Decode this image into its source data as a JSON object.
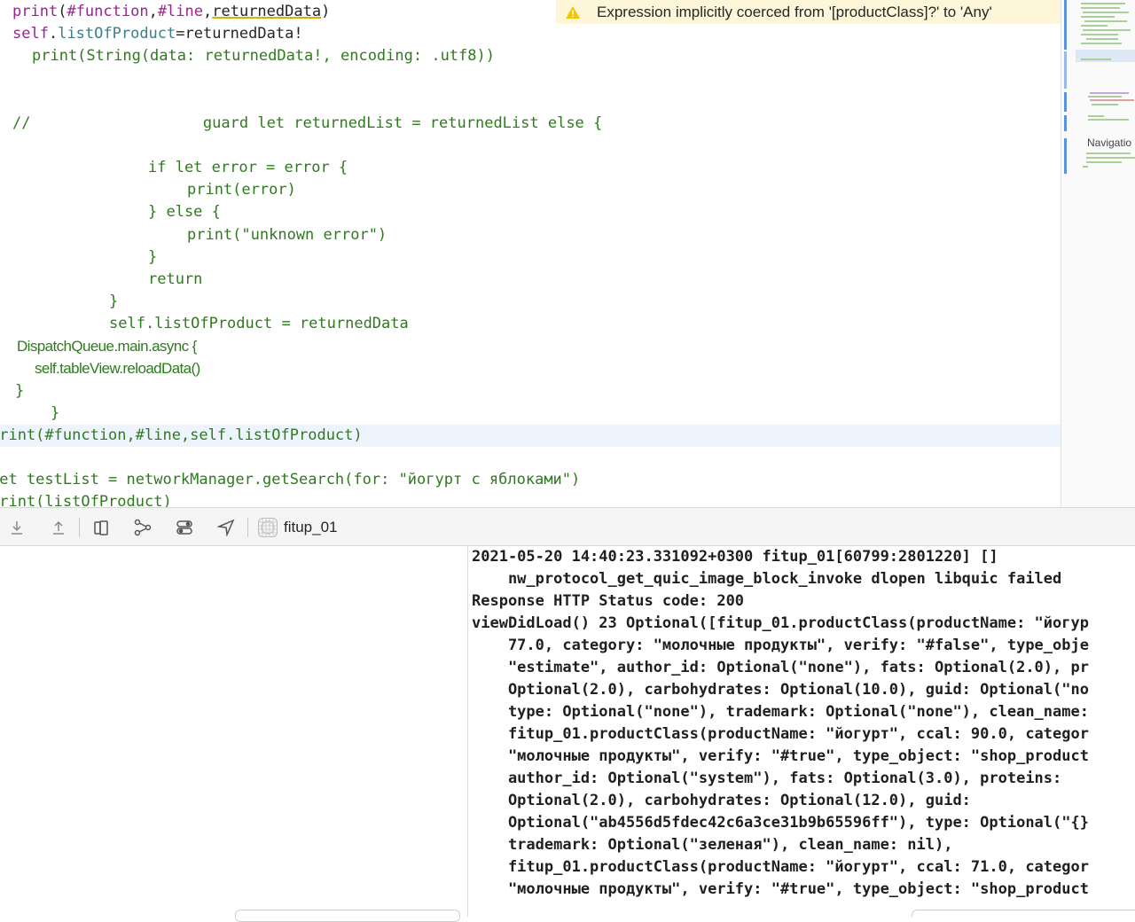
{
  "editor": {
    "warning": {
      "icon": "warning-triangle-icon",
      "text": "Expression implicitly coerced from '[productClass]?' to 'Any'"
    },
    "lines": [
      {
        "print": "print",
        "open": "(",
        "function_kw": "#function",
        "comma1": ",",
        "line_kw": "#line",
        "comma2": ",",
        "arg": "returnedData",
        "close": ")"
      },
      {
        "self_kw": "self",
        "dot": ".",
        "member": "listOfProduct",
        "rest": "=returnedData!"
      },
      {
        "text": "print(String(data: returnedData!, encoding: .utf8))"
      },
      {
        "text": "//                   guard let returnedList = returnedList else {"
      },
      {
        "text": "if let error = error {"
      },
      {
        "text": "print(error)"
      },
      {
        "text": "} else {"
      },
      {
        "text": "print(\"unknown error\")"
      },
      {
        "text": "}"
      },
      {
        "text": "return"
      },
      {
        "text": "}"
      },
      {
        "text": "self.listOfProduct = returnedData"
      },
      {
        "text": "DispatchQueue.main.async {"
      },
      {
        "text": "self.tableView.reloadData()"
      },
      {
        "text": "}"
      },
      {
        "text": "}"
      },
      {
        "text": "print(#function,#line,self.listOfProduct)"
      },
      {
        "text": "let testList = networkManager.getSearch(for: \"йогурт с яблоками\")"
      },
      {
        "text": "print(listOfProduct)"
      }
    ]
  },
  "minimap": {
    "label": "Navigatio"
  },
  "toolbar": {
    "icons": [
      "step-over-icon",
      "step-out-icon",
      "view-debugger-icon",
      "memory-graph-icon",
      "environment-overrides-icon",
      "simulate-location-icon"
    ],
    "target_icon": "app-target-icon",
    "target_label": "fitup_01"
  },
  "console": {
    "lines": [
      "2021-05-20 14:40:23.331092+0300 fitup_01[60799:2801220] []",
      "    nw_protocol_get_quic_image_block_invoke dlopen libquic failed",
      "Response HTTP Status code: 200",
      "viewDidLoad() 23 Optional([fitup_01.productClass(productName: \"йогур",
      "    77.0, category: \"молочные продукты\", verify: \"#false\", type_obje",
      "    \"estimate\", author_id: Optional(\"none\"), fats: Optional(2.0), pr",
      "    Optional(2.0), carbohydrates: Optional(10.0), guid: Optional(\"no",
      "    type: Optional(\"none\"), trademark: Optional(\"none\"), clean_name:",
      "    fitup_01.productClass(productName: \"йогурт\", ccal: 90.0, categor",
      "    \"молочные продукты\", verify: \"#true\", type_object: \"shop_product",
      "    author_id: Optional(\"system\"), fats: Optional(3.0), proteins:",
      "    Optional(2.0), carbohydrates: Optional(12.0), guid:",
      "    Optional(\"ab4556d5fdec42c6a3ce31b9b65596ff\"), type: Optional(\"{}",
      "    trademark: Optional(\"зеленая\"), clean_name: nil),",
      "    fitup_01.productClass(productName: \"йогурт\", ccal: 71.0, categor",
      "    \"молочные продукты\", verify: \"#true\", type_object: \"shop_product"
    ]
  }
}
